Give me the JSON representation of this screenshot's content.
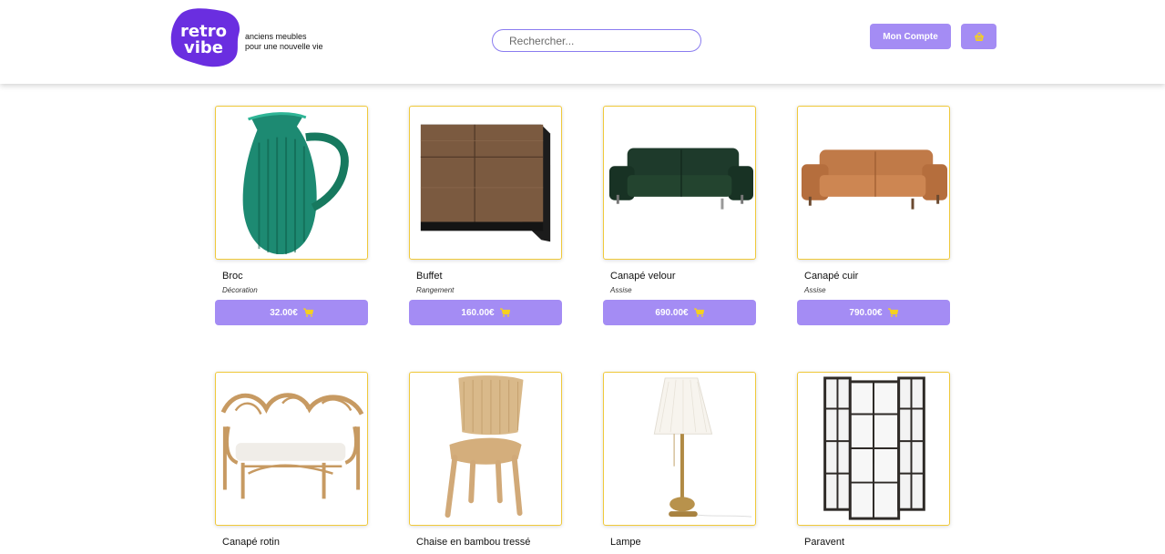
{
  "header": {
    "logo_text": "retro vibe",
    "tagline_line1": "anciens meubles",
    "tagline_line2": "pour une nouvelle vie",
    "search_placeholder": "Rechercher...",
    "account_label": "Mon Compte",
    "basket_icon": "basket-icon"
  },
  "colors": {
    "accent": "#a48cf4",
    "logo_purple": "#6a2ee0",
    "card_border": "#f0c93a",
    "cart_icon": "#f5d020"
  },
  "products": [
    {
      "name": "Broc",
      "category": "Décoration",
      "price": "32.00€",
      "image": "green-glass-pitcher"
    },
    {
      "name": "Buffet",
      "category": "Rangement",
      "price": "160.00€",
      "image": "wood-black-sideboard"
    },
    {
      "name": "Canapé velour",
      "category": "Assise",
      "price": "690.00€",
      "image": "green-velvet-sofa"
    },
    {
      "name": "Canapé cuir",
      "category": "Assise",
      "price": "790.00€",
      "image": "tan-leather-sofa"
    },
    {
      "name": "Canapé rotin",
      "category": "",
      "price": "",
      "image": "rattan-loveseat"
    },
    {
      "name": "Chaise en bambou tressé",
      "category": "",
      "price": "",
      "image": "bamboo-chair"
    },
    {
      "name": "Lampe",
      "category": "",
      "price": "",
      "image": "brass-table-lamp"
    },
    {
      "name": "Paravent",
      "category": "",
      "price": "",
      "image": "room-divider"
    }
  ]
}
